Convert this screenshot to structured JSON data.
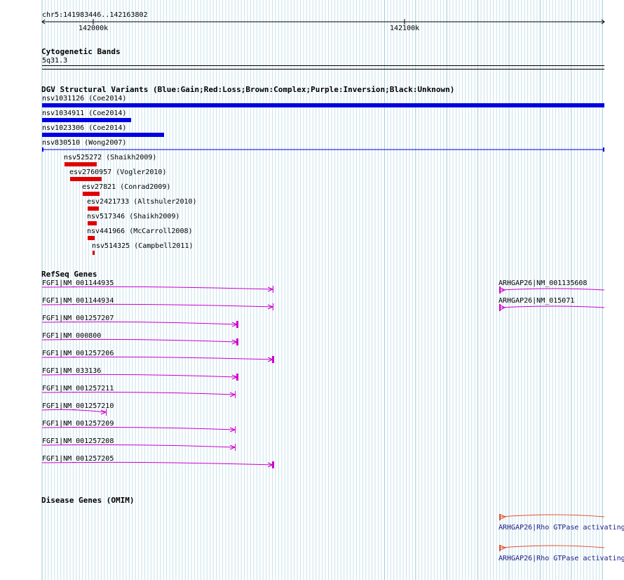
{
  "ruler": {
    "region": "chr5:141983446..142163802",
    "tick_left": "142000k",
    "tick_right": "142100k"
  },
  "cytoband": {
    "title": "Cytogenetic Bands",
    "band": "5q31.3"
  },
  "dgv": {
    "title": "DGV Structural Variants (Blue:Gain;Red:Loss;Brown:Complex;Purple:Inversion;Black:Unknown)",
    "variants": [
      "nsv1031126 (Coe2014)",
      "nsv1034911 (Coe2014)",
      "nsv1023306 (Coe2014)",
      "nsv830510 (Wong2007)",
      "nsv525272 (Shaikh2009)",
      "esv2760957 (Vogler2010)",
      "esv27821 (Conrad2009)",
      "esv2421733 (Altshuler2010)",
      "nsv517346 (Shaikh2009)",
      "nsv441966 (McCarroll2008)",
      "nsv514325 (Campbell2011)"
    ],
    "colors": {
      "gain": "#0000e0",
      "loss": "#e00000"
    }
  },
  "refseq": {
    "title": "RefSeq Genes",
    "fgf1": [
      "FGF1|NM_001144935",
      "FGF1|NM_001144934",
      "FGF1|NM_001257207",
      "FGF1|NM_000800",
      "FGF1|NM_001257206",
      "FGF1|NM_033136",
      "FGF1|NM_001257211",
      "FGF1|NM_001257210",
      "FGF1|NM_001257209",
      "FGF1|NM_001257208",
      "FGF1|NM_001257205"
    ],
    "arhgap26": [
      "ARHGAP26|NM_001135608",
      "ARHGAP26|NM_015071"
    ],
    "color": "#cc00cc"
  },
  "omim": {
    "title": "Disease Genes (OMIM)",
    "genes": [
      "ARHGAP26|Rho GTPase activating",
      "ARHGAP26|Rho GTPase activating"
    ],
    "color": "#e05030"
  }
}
